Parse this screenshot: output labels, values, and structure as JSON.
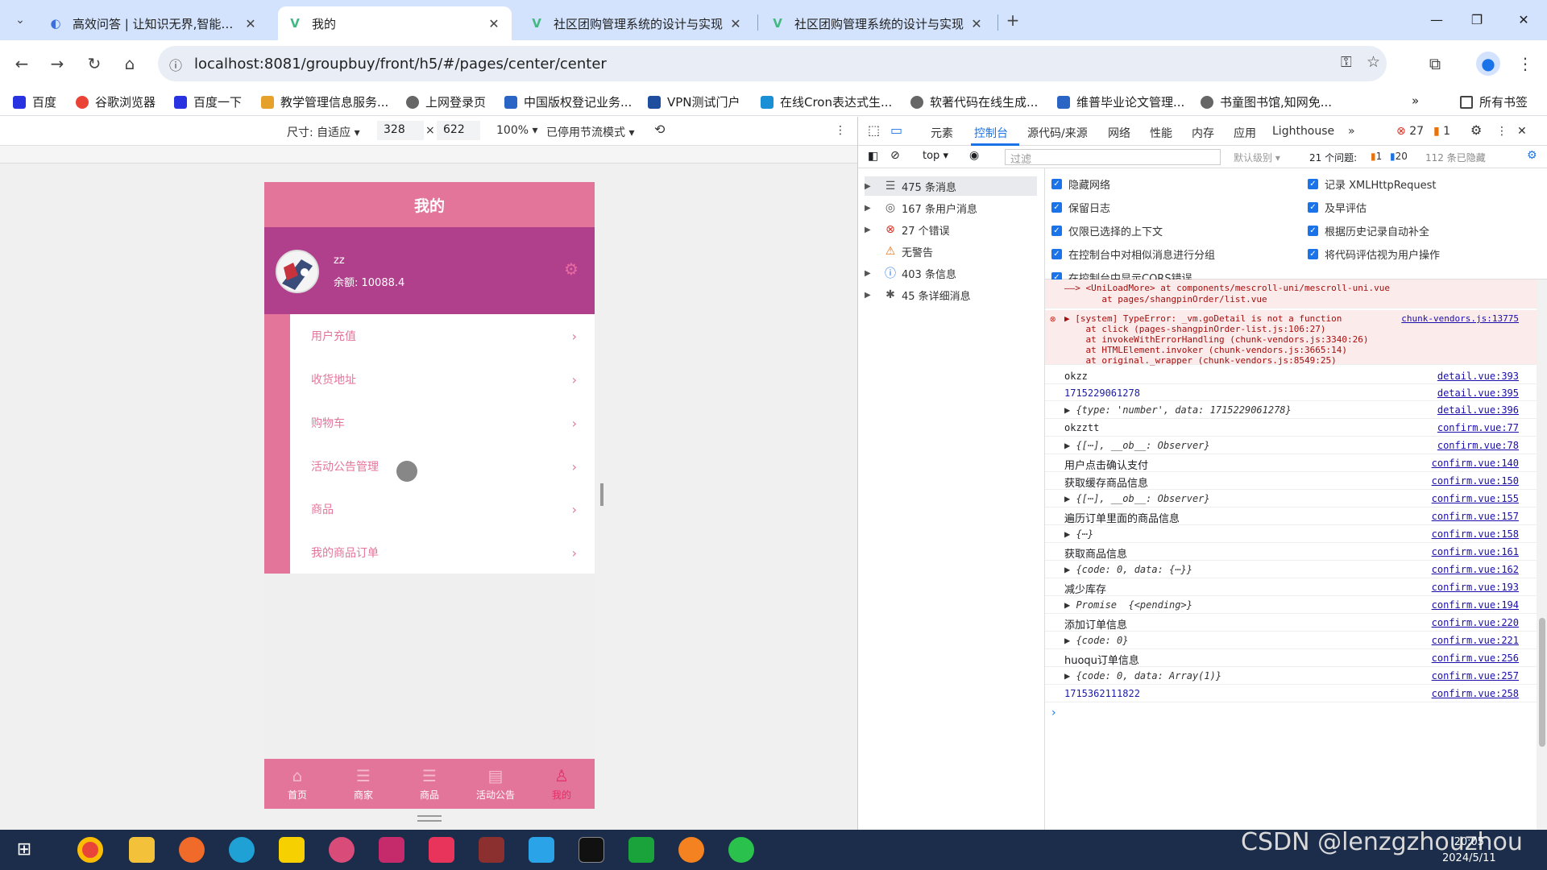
{
  "browser": {
    "tabs": [
      {
        "title": "高效问答 | 让知识无界,智能触手可及",
        "icon": "ai-icon"
      },
      {
        "title": "我的",
        "icon": "vue-icon"
      },
      {
        "title": "社区团购管理系统的设计与实现",
        "icon": "vue-icon"
      },
      {
        "title": "社区团购管理系统的设计与实现",
        "icon": "vue-icon"
      }
    ],
    "new_tab": "+",
    "url": "localhost:8081/groupbuy/front/h5/#/pages/center/center",
    "bookmarks": [
      "百度",
      "谷歌浏览器",
      "百度一下",
      "教学管理信息服务...",
      "上网登录页",
      "中国版权登记业务...",
      "VPN测试门户",
      "在线Cron表达式生...",
      "软著代码在线生成...",
      "维普毕业论文管理...",
      "书童图书馆,知网免..."
    ],
    "all_bookmarks": "所有书签"
  },
  "device_toolbar": {
    "size_label": "尺寸: 自适应",
    "width": "328",
    "times": "×",
    "height": "622",
    "zoom": "100%",
    "throttle": "已停用节流模式"
  },
  "app": {
    "header_title": "我的",
    "username": "zz",
    "balance": "余额:  10088.4",
    "menu": [
      "用户充值",
      "收货地址",
      "购物车",
      "活动公告管理",
      "商品",
      "我的商品订单"
    ],
    "tabbar": [
      {
        "label": "首页",
        "icon": "home-icon"
      },
      {
        "label": "商家",
        "icon": "list-icon"
      },
      {
        "label": "商品",
        "icon": "list-icon"
      },
      {
        "label": "活动公告",
        "icon": "clipboard-icon"
      },
      {
        "label": "我的",
        "icon": "user-icon"
      }
    ],
    "colors": {
      "header": "#e4759a",
      "user_bg": "#b0408c",
      "active": "#e0306a"
    }
  },
  "devtools": {
    "tabs": [
      "元素",
      "控制台",
      "源代码/来源",
      "网络",
      "性能",
      "内存",
      "应用",
      "Lighthouse"
    ],
    "active_tab": "控制台",
    "errors": "27",
    "warnings": "1",
    "context": "top",
    "filter_placeholder": "过滤",
    "level": "默认级别",
    "issues_label": "21 个问题:",
    "issues_warn": "1",
    "issues_info": "20",
    "hidden": "112 条已隐藏",
    "sidebar": [
      {
        "label": "475 条消息",
        "icon": "list-icon"
      },
      {
        "label": "167 条用户消息",
        "icon": "user-icon"
      },
      {
        "label": "27 个错误",
        "icon": "error-icon"
      },
      {
        "label": "无警告",
        "icon": "warning-icon"
      },
      {
        "label": "403 条信息",
        "icon": "info-icon"
      },
      {
        "label": "45 条详细消息",
        "icon": "bug-icon"
      }
    ],
    "settings": [
      "隐藏网络",
      "记录 XMLHttpRequest",
      "保留日志",
      "及早评估",
      "仅限已选择的上下文",
      "根据历史记录自动补全",
      "在控制台中对相似消息进行分组",
      "将代码评估视为用户操作",
      "在控制台中显示CORS错误"
    ],
    "console": [
      {
        "text": "——> <UniLoadMore> at components/mescroll-uni/mescroll-uni.vue\n       at pages/shangpinOrder/list.vue",
        "src": ""
      },
      {
        "text": "▶ [system] TypeError: _vm.goDetail is not a function\n    at click (pages-shangpinOrder-list.js:106:27)\n    at invokeWithErrorHandling (chunk-vendors.js:3340:26)\n    at HTMLElement.invoker (chunk-vendors.js:3665:14)\n    at original._wrapper (chunk-vendors.js:8549:25)",
        "src": "chunk-vendors.js:13775"
      },
      {
        "text": "okzz",
        "src": "detail.vue:393"
      },
      {
        "text": "1715229061278",
        "src": "detail.vue:395"
      },
      {
        "text": "▶ {type: 'number', data: 1715229061278}",
        "src": "detail.vue:396"
      },
      {
        "text": "okzztt",
        "src": "confirm.vue:77"
      },
      {
        "text": "▶ {[⋯], __ob__: Observer}",
        "src": "confirm.vue:78"
      },
      {
        "text": "用户点击确认支付",
        "src": "confirm.vue:140"
      },
      {
        "text": "获取缓存商品信息",
        "src": "confirm.vue:150"
      },
      {
        "text": "▶ {[⋯], __ob__: Observer}",
        "src": "confirm.vue:155"
      },
      {
        "text": "遍历订单里面的商品信息",
        "src": "confirm.vue:157"
      },
      {
        "text": "▶ {⋯}",
        "src": "confirm.vue:158"
      },
      {
        "text": "获取商品信息",
        "src": "confirm.vue:161"
      },
      {
        "text": "▶ {code: 0, data: {⋯}}",
        "src": "confirm.vue:162"
      },
      {
        "text": "减少库存",
        "src": "confirm.vue:193"
      },
      {
        "text": "▶ Promise  {<pending>}",
        "src": "confirm.vue:194"
      },
      {
        "text": "添加订单信息",
        "src": "confirm.vue:220"
      },
      {
        "text": "▶ {code: 0}",
        "src": "confirm.vue:221"
      },
      {
        "text": "huoqu订单信息",
        "src": "confirm.vue:256"
      },
      {
        "text": "▶ {code: 0, data: Array(1)}",
        "src": "confirm.vue:257"
      },
      {
        "text": "1715362111822",
        "src": "confirm.vue:258"
      }
    ],
    "prompt": "›"
  },
  "taskbar": {
    "watermark": "CSDN @lenzgzhouzhou",
    "time": "20:05",
    "date": "2024/5/11"
  }
}
